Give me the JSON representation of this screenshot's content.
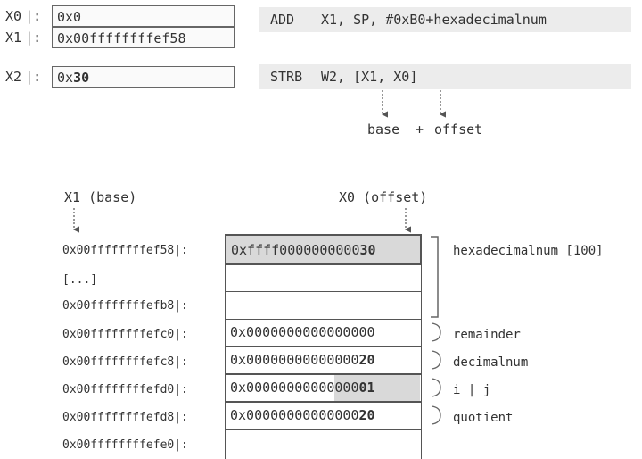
{
  "registers": [
    {
      "name": "X0",
      "value": "0x0"
    },
    {
      "name": "X1",
      "value": "0x00ffffffffef58"
    },
    {
      "name": "X2",
      "value_prefix": "0x",
      "value_bold": "30"
    }
  ],
  "instructions": {
    "add": {
      "mnemonic": "ADD",
      "operands": "X1, SP, #0xB0+hexadecimalnum"
    },
    "strb": {
      "mnemonic": "STRB",
      "operands": "W2, [X1, X0]"
    }
  },
  "addressing_caption": {
    "base": "base",
    "plus": "+",
    "offset": "offset"
  },
  "pointer_labels": {
    "x1": "X1 (base)",
    "x0": "X0 (offset)"
  },
  "separator": "|:",
  "memory": [
    {
      "address": "0x00ffffffffef58",
      "value_prefix": "0xffff0000000000",
      "value_bold": "30",
      "highlight": "full"
    },
    {
      "address": "[...]",
      "value_prefix": "",
      "value_bold": ""
    },
    {
      "address": "0x00ffffffffefb8",
      "value_prefix": "",
      "value_bold": ""
    },
    {
      "address": "0x00ffffffffefc0",
      "value_prefix": "0x0000000000000000",
      "value_bold": ""
    },
    {
      "address": "0x00ffffffffefc8",
      "value_prefix": "0x00000000000000",
      "value_bold": "20"
    },
    {
      "address": "0x00ffffffffefd0",
      "value_prefix": "0x00000000000000",
      "value_bold": "01",
      "highlight": "partial"
    },
    {
      "address": "0x00ffffffffefd8",
      "value_prefix": "0x00000000000000",
      "value_bold": "20"
    },
    {
      "address": "0x00ffffffffefe0",
      "value_prefix": "",
      "value_bold": ""
    }
  ],
  "variable_labels": {
    "hexadecimalnum": "hexadecimalnum [100]",
    "remainder": "remainder",
    "decimalnum": "decimalnum",
    "ij": "i | j",
    "quotient": "quotient"
  },
  "colors": {
    "text": "#333333",
    "highlight": "#d9d9d9",
    "instruction_bg": "#ececec",
    "border": "#555555"
  }
}
